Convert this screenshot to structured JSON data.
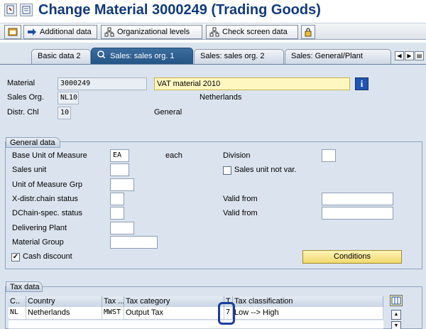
{
  "window": {
    "title": "Change Material 3000249 (Trading Goods)"
  },
  "toolbar": {
    "additional_data": "Additional data",
    "organizational_levels": "Organizational levels",
    "check_screen_data": "Check screen data"
  },
  "tabs": [
    {
      "label": "Basic data 2",
      "active": false
    },
    {
      "label": "Sales: sales org. 1",
      "active": true
    },
    {
      "label": "Sales: sales org. 2",
      "active": false
    },
    {
      "label": "Sales: General/Plant",
      "active": false
    }
  ],
  "header": {
    "material_label": "Material",
    "material_value": "3000249",
    "material_desc": "VAT material 2010",
    "sales_org_label": "Sales Org.",
    "sales_org_value": "NL10",
    "sales_org_desc": "Netherlands",
    "distr_chl_label": "Distr. Chl",
    "distr_chl_value": "10",
    "distr_chl_desc": "General"
  },
  "general_data": {
    "title": "General data",
    "base_uom_label": "Base Unit of Measure",
    "base_uom_value": "EA",
    "base_uom_desc": "each",
    "division_label": "Division",
    "division_value": "",
    "sales_unit_label": "Sales unit",
    "sales_unit_value": "",
    "sales_unit_not_var_label": "Sales unit not var.",
    "sales_unit_not_var_checked": false,
    "uom_grp_label": "Unit of Measure Grp",
    "uom_grp_value": "",
    "x_distr_label": "X-distr.chain status",
    "x_distr_value": "",
    "valid_from_label": "Valid from",
    "valid_from_value_1": "",
    "dchain_label": "DChain-spec. status",
    "dchain_value": "",
    "valid_from_label_2": "Valid from",
    "valid_from_value_2": "",
    "delivering_plant_label": "Delivering Plant",
    "delivering_plant_value": "",
    "material_group_label": "Material Group",
    "material_group_value": "",
    "cash_discount_label": "Cash discount",
    "cash_discount_mark": "✓",
    "conditions_label": "Conditions"
  },
  "tax_data": {
    "title": "Tax data",
    "columns": [
      "C..",
      "Country",
      "Tax ...",
      "Tax category",
      "T",
      "Tax classification"
    ],
    "rows": [
      [
        "NL",
        "Netherlands",
        "MWST",
        "Output Tax",
        "7",
        "Low --> High"
      ]
    ]
  },
  "colors": {
    "accent": "#123a7a",
    "active_tab": "#2c5c8e",
    "highlight_ring": "#1b3f9c",
    "conditions_button": "#f1d870"
  }
}
